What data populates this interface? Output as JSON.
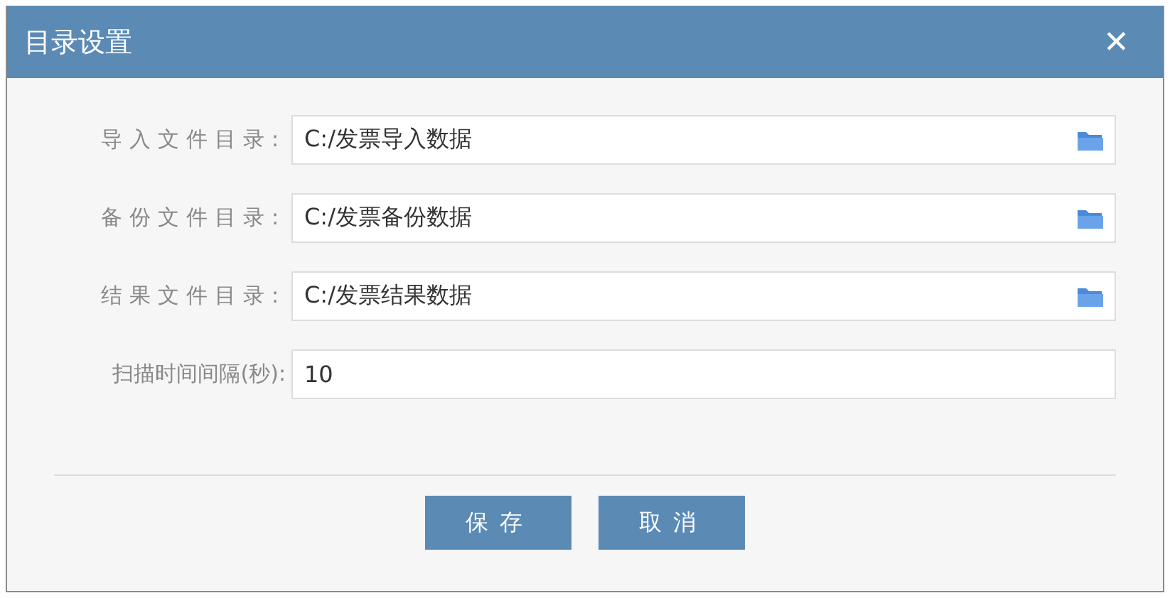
{
  "window": {
    "title": "目录设置",
    "close": "✕"
  },
  "fields": [
    {
      "label": "导入文件目录:",
      "value": "C:/发票导入数据",
      "browse": true
    },
    {
      "label": "备份文件目录:",
      "value": "C:/发票备份数据",
      "browse": true
    },
    {
      "label": "结果文件目录:",
      "value": "C:/发票结果数据",
      "browse": true
    },
    {
      "label": "扫描时间间隔(秒):",
      "value": "10",
      "browse": false
    }
  ],
  "buttons": [
    "保存",
    "取消"
  ]
}
